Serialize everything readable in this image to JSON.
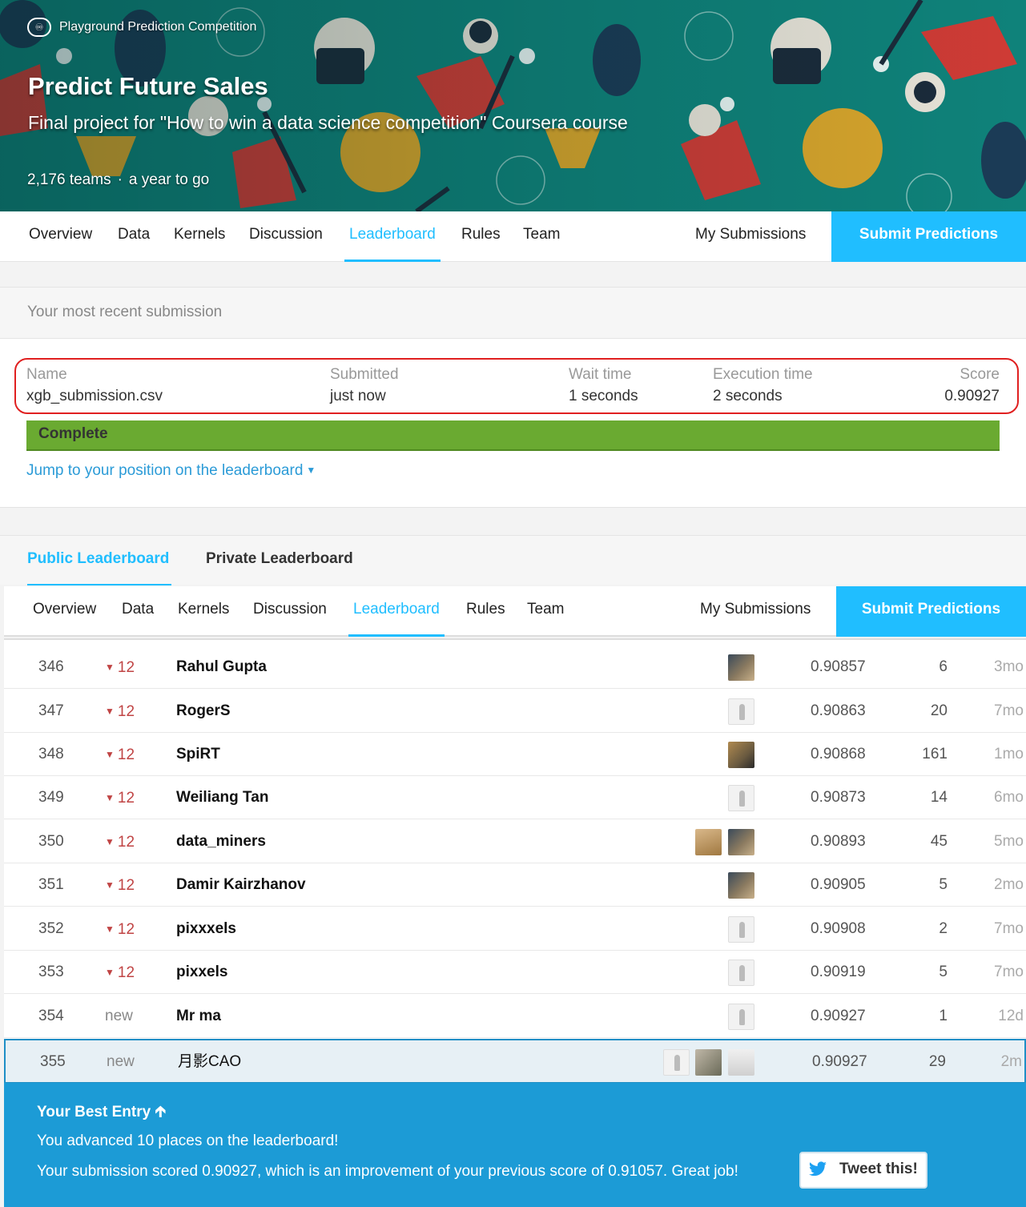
{
  "hero": {
    "kind": "Playground Prediction Competition",
    "title": "Predict Future Sales",
    "subtitle": "Final project for \"How to win a data science competition\" Coursera course",
    "teams": "2,176 teams",
    "deadline": "a year to go"
  },
  "nav": {
    "tabs": [
      "Overview",
      "Data",
      "Kernels",
      "Discussion",
      "Leaderboard",
      "Rules",
      "Team"
    ],
    "active": "Leaderboard",
    "my_submissions": "My Submissions",
    "submit": "Submit Predictions"
  },
  "recent": {
    "heading": "Your most recent submission",
    "name_h": "Name",
    "name": "xgb_submission.csv",
    "submitted_h": "Submitted",
    "submitted": "just now",
    "wait_h": "Wait time",
    "wait": "1 seconds",
    "exec_h": "Execution time",
    "exec": "2 seconds",
    "score_h": "Score",
    "score": "0.90927",
    "status": "Complete",
    "jump": "Jump to your position on the leaderboard"
  },
  "leaderboard_tabs": {
    "public": "Public Leaderboard",
    "private": "Private Leaderboard"
  },
  "rows": [
    {
      "rank": "346",
      "change": "12",
      "team": "Rahul Gupta",
      "score": "0.90857",
      "entries": "6",
      "last": "3mo"
    },
    {
      "rank": "347",
      "change": "12",
      "team": "RogerS",
      "score": "0.90863",
      "entries": "20",
      "last": "7mo"
    },
    {
      "rank": "348",
      "change": "12",
      "team": "SpiRT",
      "score": "0.90868",
      "entries": "161",
      "last": "1mo"
    },
    {
      "rank": "349",
      "change": "12",
      "team": "Weiliang Tan",
      "score": "0.90873",
      "entries": "14",
      "last": "6mo"
    },
    {
      "rank": "350",
      "change": "12",
      "team": "data_miners",
      "score": "0.90893",
      "entries": "45",
      "last": "5mo"
    },
    {
      "rank": "351",
      "change": "12",
      "team": "Damir Kairzhanov",
      "score": "0.90905",
      "entries": "5",
      "last": "2mo"
    },
    {
      "rank": "352",
      "change": "12",
      "team": "pixxxels",
      "score": "0.90908",
      "entries": "2",
      "last": "7mo"
    },
    {
      "rank": "353",
      "change": "12",
      "team": "pixxels",
      "score": "0.90919",
      "entries": "5",
      "last": "7mo"
    },
    {
      "rank": "354",
      "change": "new",
      "team": "Mr ma",
      "score": "0.90927",
      "entries": "1",
      "last": "12d"
    },
    {
      "rank": "355",
      "change": "new",
      "team": "月影CAO",
      "score": "0.90927",
      "entries": "29",
      "last": "2m"
    }
  ],
  "banner": {
    "title": "Your Best Entry",
    "line1": "You advanced 10 places on the leaderboard!",
    "line2": "Your submission scored 0.90927, which is an improvement of your previous score of 0.91057. Great job!",
    "tweet": "Tweet this!"
  },
  "colors": {
    "accent": "#20beff",
    "complete": "#6aaa31",
    "banner": "#1c9bd6",
    "highlight_border": "#e02020",
    "drop": "#c04444"
  }
}
